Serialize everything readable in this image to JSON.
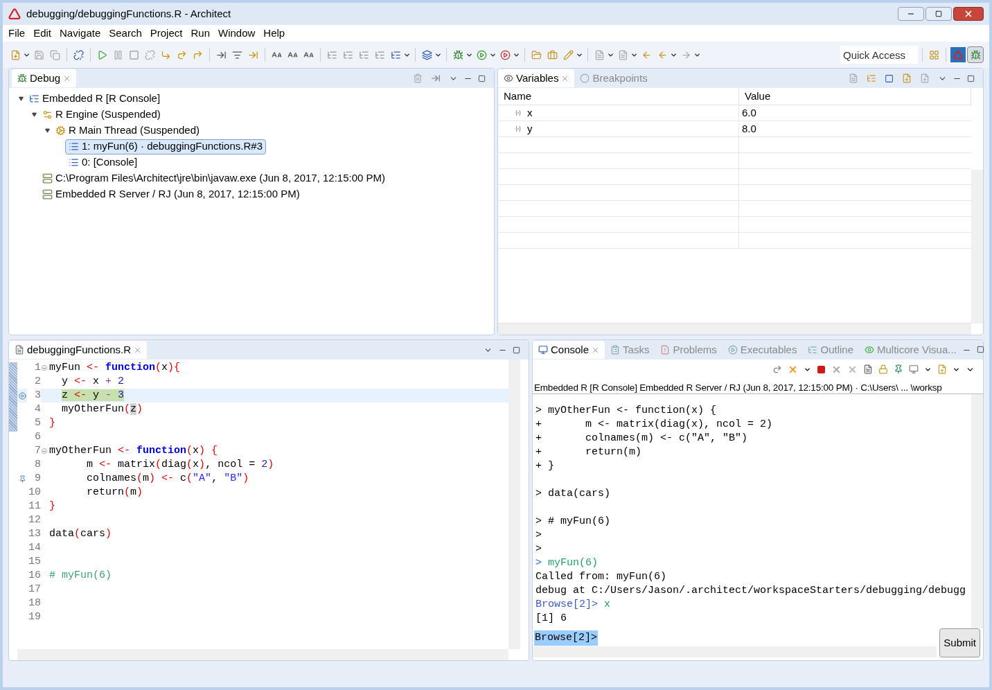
{
  "window": {
    "title": "debugging/debuggingFunctions.R - Architect"
  },
  "menu": [
    "File",
    "Edit",
    "Navigate",
    "Search",
    "Project",
    "Run",
    "Window",
    "Help"
  ],
  "quick_access": {
    "placeholder": "Quick Access"
  },
  "debug_view": {
    "tab": {
      "label": "Debug",
      "selected": true
    },
    "tree": [
      {
        "label": "Embedded R [R Console]",
        "kind": "launch",
        "expanded": true,
        "selected": false,
        "children": [
          {
            "label": "R Engine (Suspended)",
            "kind": "engine",
            "expanded": true,
            "selected": false,
            "children": [
              {
                "label": "R Main Thread (Suspended)",
                "kind": "thread",
                "expanded": true,
                "selected": false,
                "children": [
                  {
                    "label": "1: myFun(6)  ·  debuggingFunctions.R#3",
                    "kind": "frame",
                    "selected": true
                  },
                  {
                    "label": "0: [Console]",
                    "kind": "frame",
                    "selected": false
                  }
                ]
              }
            ]
          },
          {
            "label": "C:\\Program Files\\Architect\\jre\\bin\\javaw.exe (Jun 8, 2017, 12:15:00 PM)",
            "kind": "process",
            "selected": false
          },
          {
            "label": "Embedded R Server / RJ (Jun 8, 2017, 12:15:00 PM)",
            "kind": "process",
            "selected": false
          }
        ]
      }
    ]
  },
  "variables_view": {
    "tabs": [
      {
        "label": "Variables",
        "selected": true
      },
      {
        "label": "Breakpoints",
        "selected": false
      }
    ],
    "columns": [
      "Name",
      "Value"
    ],
    "rows": [
      {
        "name": "x",
        "value": "6.0"
      },
      {
        "name": "y",
        "value": "8.0"
      }
    ]
  },
  "editor": {
    "tab": {
      "label": "debuggingFunctions.R",
      "selected": true
    },
    "lines": [
      {
        "number": "1",
        "foldable": true,
        "current": false,
        "tokens": [
          {
            "kind": "plain",
            "t": "myFun "
          },
          {
            "kind": "op",
            "t": "<- "
          },
          {
            "kind": "kw",
            "t": "function"
          },
          {
            "kind": "op",
            "t": "("
          },
          {
            "kind": "plain",
            "t": "x"
          },
          {
            "kind": "op",
            "t": "){"
          }
        ]
      },
      {
        "number": "2",
        "foldable": false,
        "current": false,
        "tokens": [
          {
            "kind": "plain",
            "t": "  y "
          },
          {
            "kind": "op",
            "t": "<- "
          },
          {
            "kind": "plain",
            "t": "x "
          },
          {
            "kind": "minus",
            "t": "+ "
          },
          {
            "kind": "num",
            "t": "2"
          }
        ]
      },
      {
        "number": "3",
        "kind": "pointer",
        "foldable": false,
        "current": true,
        "tokens": [
          {
            "kind": "plain",
            "t": "  z "
          },
          {
            "kind": "op",
            "t": "<- "
          },
          {
            "kind": "plain",
            "t": "y "
          },
          {
            "kind": "minus",
            "t": "- "
          },
          {
            "kind": "num",
            "t": "3"
          }
        ]
      },
      {
        "number": "4",
        "foldable": false,
        "current": false,
        "tokens": [
          {
            "kind": "plain",
            "t": "  myOtherFun"
          },
          {
            "kind": "op",
            "t": "("
          },
          {
            "kind": "match",
            "t": "z"
          },
          {
            "kind": "op",
            "t": ")"
          }
        ]
      },
      {
        "number": "5",
        "foldable": false,
        "current": false,
        "tokens": [
          {
            "kind": "op",
            "t": "}"
          }
        ]
      },
      {
        "number": "6",
        "foldable": false,
        "current": false
      },
      {
        "number": "7",
        "foldable": true,
        "current": false,
        "tokens": [
          {
            "kind": "plain",
            "t": "myOtherFun "
          },
          {
            "kind": "op",
            "t": "<- "
          },
          {
            "kind": "kw",
            "t": "function"
          },
          {
            "kind": "op",
            "t": "("
          },
          {
            "kind": "plain",
            "t": "x"
          },
          {
            "kind": "op",
            "t": ") {"
          }
        ]
      },
      {
        "number": "8",
        "foldable": false,
        "current": false,
        "tokens": [
          {
            "kind": "plain",
            "t": "      m "
          },
          {
            "kind": "op",
            "t": "<- "
          },
          {
            "kind": "plain",
            "t": "matrix"
          },
          {
            "kind": "op",
            "t": "("
          },
          {
            "kind": "plain",
            "t": "diag"
          },
          {
            "kind": "op",
            "t": "("
          },
          {
            "kind": "plain",
            "t": "x"
          },
          {
            "kind": "op",
            "t": ")"
          },
          {
            "kind": "plain",
            "t": ", ncol = "
          },
          {
            "kind": "num",
            "t": "2"
          },
          {
            "kind": "op",
            "t": ")"
          }
        ]
      },
      {
        "number": "9",
        "kind": "breakpoint",
        "foldable": false,
        "current": false,
        "tokens": [
          {
            "kind": "plain",
            "t": "      colnames"
          },
          {
            "kind": "op",
            "t": "("
          },
          {
            "kind": "plain",
            "t": "m"
          },
          {
            "kind": "op",
            "t": ") <- "
          },
          {
            "kind": "plain",
            "t": "c"
          },
          {
            "kind": "op",
            "t": "("
          },
          {
            "kind": "str",
            "t": "\"A\""
          },
          {
            "kind": "plain",
            "t": ", "
          },
          {
            "kind": "str",
            "t": "\"B\""
          },
          {
            "kind": "op",
            "t": ")"
          }
        ]
      },
      {
        "number": "10",
        "foldable": false,
        "current": false,
        "tokens": [
          {
            "kind": "plain",
            "t": "      return"
          },
          {
            "kind": "op",
            "t": "("
          },
          {
            "kind": "plain",
            "t": "m"
          },
          {
            "kind": "op",
            "t": ")"
          }
        ]
      },
      {
        "number": "11",
        "foldable": false,
        "current": false,
        "tokens": [
          {
            "kind": "op",
            "t": "}"
          }
        ]
      },
      {
        "number": "12",
        "foldable": false,
        "current": false
      },
      {
        "number": "13",
        "foldable": false,
        "current": false,
        "tokens": [
          {
            "kind": "plain",
            "t": "data"
          },
          {
            "kind": "op",
            "t": "("
          },
          {
            "kind": "plain",
            "t": "cars"
          },
          {
            "kind": "op",
            "t": ")"
          }
        ]
      },
      {
        "number": "14",
        "foldable": false,
        "current": false
      },
      {
        "number": "15",
        "foldable": false,
        "current": false
      },
      {
        "number": "16",
        "foldable": false,
        "current": false,
        "tokens": [
          {
            "kind": "comment",
            "t": "# myFun(6)"
          }
        ]
      },
      {
        "number": "17",
        "foldable": false,
        "current": false
      },
      {
        "number": "18",
        "foldable": false,
        "current": false
      },
      {
        "number": "19",
        "foldable": false,
        "current": false
      }
    ]
  },
  "console_view": {
    "tabs": [
      {
        "label": "Console",
        "selected": true
      },
      {
        "label": "Tasks",
        "selected": false
      },
      {
        "label": "Problems",
        "selected": false
      },
      {
        "label": "Executables",
        "selected": false
      },
      {
        "label": "Outline",
        "selected": false
      },
      {
        "label": "Multicore Visua...",
        "selected": false
      }
    ],
    "description": "Embedded R [R Console] Embedded R Server / RJ (Jun 8, 2017, 12:15:00 PM)  ·  C:\\Users\\ ... \\worksp",
    "blocks": [
      [
        {
          "segments": [
            {
              "kind": "plain",
              "t": "> myOtherFun <- function(x) {"
            }
          ]
        },
        {
          "segments": [
            {
              "kind": "plain",
              "t": "+       m <- matrix(diag(x), ncol = 2)"
            }
          ]
        },
        {
          "segments": [
            {
              "kind": "plain",
              "t": "+       colnames(m) <- c(\"A\", \"B\")"
            }
          ]
        },
        {
          "segments": [
            {
              "kind": "plain",
              "t": "+       return(m)"
            }
          ]
        },
        {
          "segments": [
            {
              "kind": "plain",
              "t": "+ }"
            }
          ]
        }
      ],
      [
        {
          "segments": [
            {
              "kind": "plain",
              "t": "> data(cars)"
            }
          ]
        }
      ],
      [
        {
          "segments": [
            {
              "kind": "plain",
              "t": "> # myFun(6)"
            }
          ]
        },
        {
          "segments": [
            {
              "kind": "plain",
              "t": ">"
            }
          ]
        },
        {
          "segments": [
            {
              "kind": "plain",
              "t": ">"
            }
          ]
        },
        {
          "segments": [
            {
              "kind": "prompt",
              "t": ">"
            },
            {
              "kind": "cmd",
              "t": " myFun(6)"
            }
          ]
        },
        {
          "segments": [
            {
              "kind": "plain",
              "t": "Called from: myFun(6)"
            }
          ]
        },
        {
          "segments": [
            {
              "kind": "plain",
              "t": "debug at C:/Users/Jason/.architect/workspaceStarters/debugging/debugg"
            }
          ]
        },
        {
          "segments": [
            {
              "kind": "prompt",
              "t": "Browse[2]>"
            },
            {
              "kind": "cmd",
              "t": " x"
            }
          ]
        },
        {
          "segments": [
            {
              "kind": "plain",
              "t": "[1] 6"
            }
          ]
        }
      ]
    ],
    "input_prompt": "Browse[2]>",
    "submit": "Submit"
  }
}
